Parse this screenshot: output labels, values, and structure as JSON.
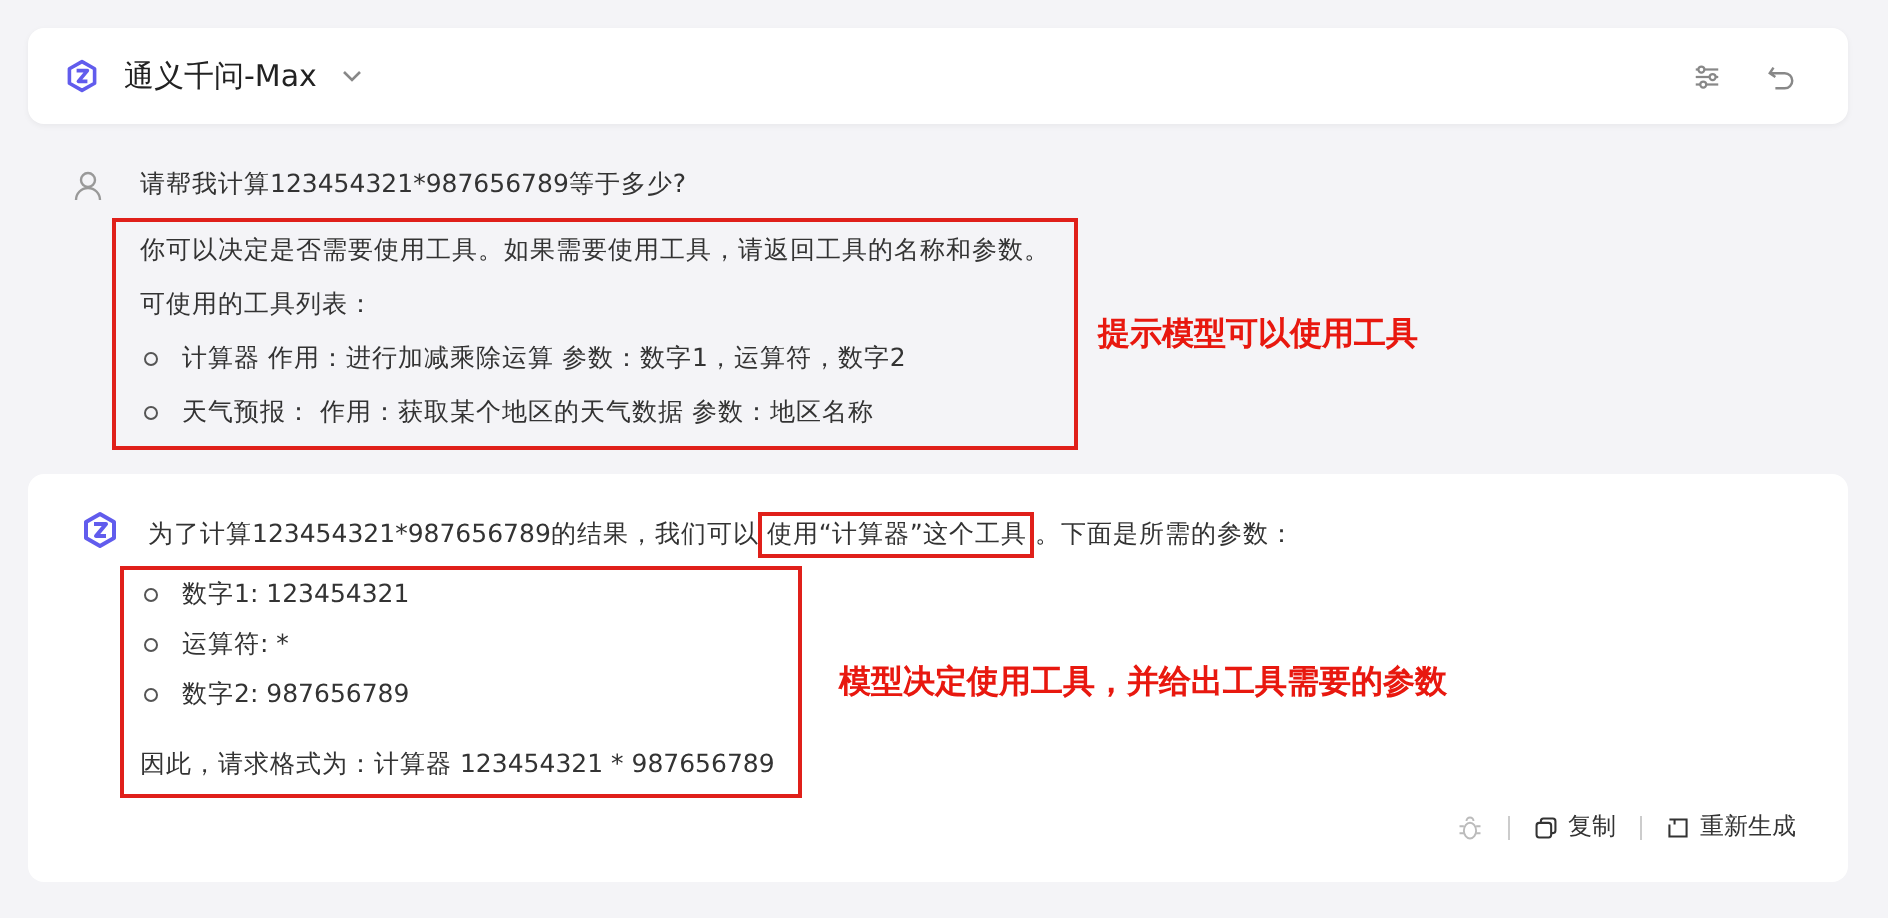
{
  "header": {
    "model_name": "通义千问-Max"
  },
  "user_message": {
    "question": "请帮我计算123454321*987656789等于多少?",
    "prompt_lines": [
      "你可以决定是否需要使用工具。如果需要使用工具，请返回工具的名称和参数。",
      "可使用的工具列表："
    ],
    "tools": [
      "计算器 作用：进行加减乘除运算 参数：数字1，运算符，数字2",
      "天气预报： 作用：获取某个地区的天气数据 参数：地区名称"
    ],
    "annotation": "提示模型可以使用工具"
  },
  "assistant_message": {
    "intro_before": "为了计算123454321*987656789的结果，我们可以",
    "intro_highlight": "使用“计算器”这个工具",
    "intro_after": "。下面是所需的参数：",
    "params": [
      "数字1: 123454321",
      "运算符: *",
      "数字2: 987656789"
    ],
    "conclusion": "因此，请求格式为：计算器 123454321 * 987656789",
    "annotation": "模型决定使用工具，并给出工具需要的参数",
    "actions": [
      {
        "kind": "bug"
      },
      {
        "kind": "copy",
        "label": "复制"
      },
      {
        "kind": "regenerate",
        "label": "重新生成"
      }
    ]
  }
}
